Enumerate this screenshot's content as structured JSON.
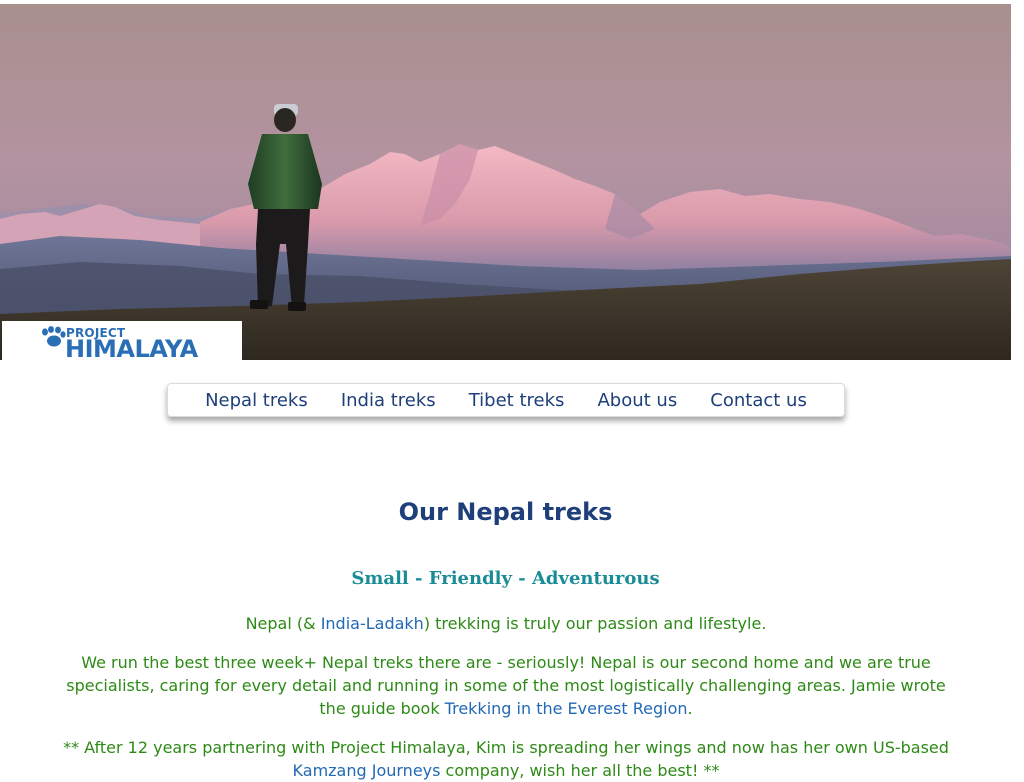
{
  "logo": {
    "line1": "PROJECT",
    "line2": "HIMALAYA"
  },
  "nav": {
    "items": [
      "Nepal treks",
      "India treks",
      "Tibet treks",
      "About us",
      "Contact us"
    ]
  },
  "main": {
    "title": "Our Nepal treks",
    "tagline": "Small - Friendly - Adventurous",
    "p1": {
      "before": "Nepal (& ",
      "link": "India-Ladakh",
      "after": ") trekking is truly our passion and lifestyle."
    },
    "p2": {
      "before": "We run the best three week+ Nepal treks there are - seriously! Nepal is our second home and we are true specialists, caring for every detail and running in some of the most logistically challenging areas. Jamie wrote the guide book ",
      "link": "Trekking in the Everest Region",
      "after": "."
    },
    "p3": {
      "before": "** After 12 years partnering with Project Himalaya, Kim is spreading her wings and now has her own US-based ",
      "link": "Kamzang Journeys",
      "after": " company, wish her all the best! **"
    }
  },
  "colors": {
    "nav_text": "#1e3f7a",
    "title": "#1e3f7a",
    "tagline": "#1a8c96",
    "body_text": "#2d8a16",
    "link": "#2269b5",
    "logo": "#2a6fb6"
  },
  "icons": {
    "logo": "paw-print-icon"
  }
}
